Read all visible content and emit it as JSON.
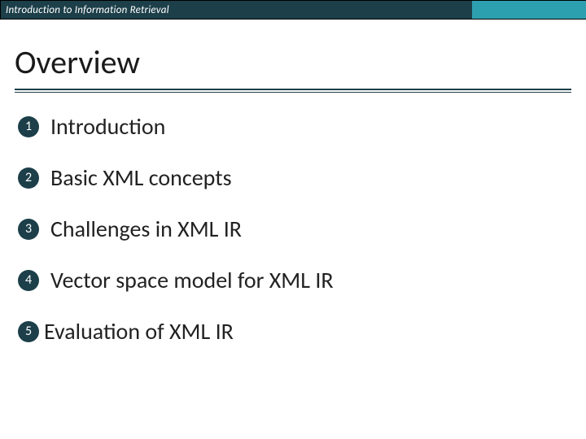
{
  "header": {
    "title": "Introduction to Information Retrieval"
  },
  "page": {
    "title": "Overview"
  },
  "toc": {
    "items": [
      {
        "num": "1",
        "label": "Introduction"
      },
      {
        "num": "2",
        "label": "Basic XML concepts"
      },
      {
        "num": "3",
        "label": "Challenges in XML IR"
      },
      {
        "num": "4",
        "label": "Vector space model for XML IR"
      },
      {
        "num": "5",
        "label": "Evaluation of XML IR"
      }
    ]
  }
}
